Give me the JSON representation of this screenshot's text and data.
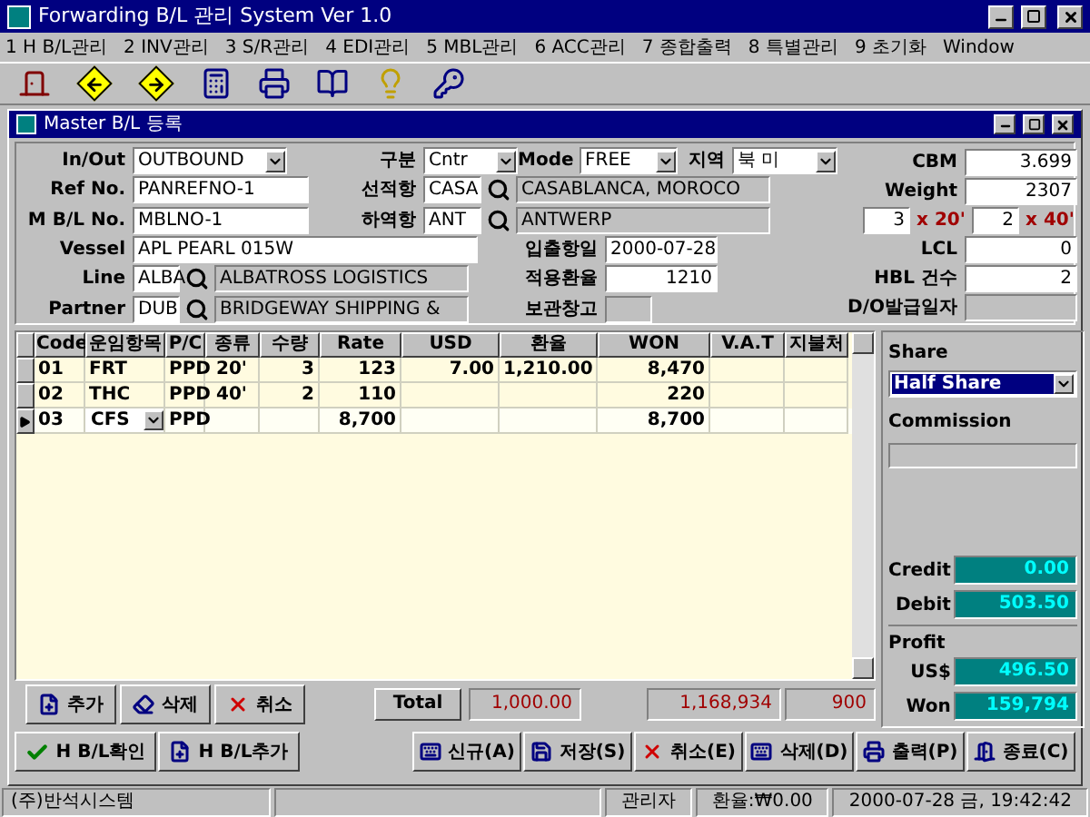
{
  "window": {
    "title": "Forwarding B/L 관리 System Ver 1.0"
  },
  "menu": [
    {
      "label": "1 H B/L관리"
    },
    {
      "label": "2 INV관리"
    },
    {
      "label": "3 S/R관리"
    },
    {
      "label": "4 EDI관리"
    },
    {
      "label": "5 MBL관리"
    },
    {
      "label": "6 ACC관리"
    },
    {
      "label": "7 종합출력"
    },
    {
      "label": "8 특별관리"
    },
    {
      "label": "9 초기화"
    },
    {
      "label": "Window"
    }
  ],
  "child_window": {
    "title": "Master B/L 등록"
  },
  "form": {
    "in_out": {
      "label": "In/Out",
      "value": "OUTBOUND"
    },
    "ref_no": {
      "label": "Ref No.",
      "value": "PANREFNO-1"
    },
    "mbl_no": {
      "label": "M B/L No.",
      "value": "MBLNO-1"
    },
    "vessel": {
      "label": "Vessel",
      "value": "APL PEARL 015W"
    },
    "line": {
      "label": "Line",
      "code": "ALBA",
      "name": "ALBATROSS LOGISTICS"
    },
    "partner": {
      "label": "Partner",
      "code": "DUB",
      "name": "BRIDGEWAY SHIPPING &"
    },
    "type": {
      "label": "구분",
      "value": "Cntr"
    },
    "mode": {
      "label": "Mode",
      "value": "FREE"
    },
    "region": {
      "label": "지역",
      "value": "북 미"
    },
    "loading_port": {
      "label": "선적항",
      "code": "CASA",
      "name": "CASABLANCA, MOROCO"
    },
    "discharge_port": {
      "label": "하역항",
      "code": "ANT",
      "name": "ANTWERP"
    },
    "date": {
      "label": "입출항일",
      "value": "2000-07-28"
    },
    "fx_rate": {
      "label": "적용환율",
      "value": "1210"
    },
    "warehouse": {
      "label": "보관창고"
    },
    "cbm": {
      "label": "CBM",
      "value": "3.699"
    },
    "weight": {
      "label": "Weight",
      "value": "2307"
    },
    "containers": [
      {
        "count": "3",
        "size": "x 20'"
      },
      {
        "count": "2",
        "size": "x 40'"
      }
    ],
    "lcl": {
      "label": "LCL",
      "value": "0"
    },
    "hbl_count": {
      "label": "HBL 건수",
      "value": "2"
    },
    "do_date": {
      "label": "D/O발급일자"
    }
  },
  "grid": {
    "columns": [
      "Code",
      "운임항목",
      "P/C",
      "종류",
      "수량",
      "Rate",
      "USD",
      "환율",
      "WON",
      "V.A.T",
      "지불처"
    ],
    "rows": [
      {
        "selected": false,
        "cells": [
          "01",
          "FRT",
          "PPD",
          "20'",
          "3",
          "123",
          "7.00",
          "1,210.00",
          "8,470",
          null,
          null
        ]
      },
      {
        "selected": false,
        "cells": [
          "02",
          "THC",
          "PPD",
          "40'",
          "2",
          "110",
          null,
          null,
          "220",
          null,
          null
        ]
      },
      {
        "selected": true,
        "cells": [
          "03",
          "CFS",
          "PPD",
          null,
          null,
          "8,700",
          null,
          null,
          "8,700",
          null,
          null
        ]
      }
    ]
  },
  "row_buttons": [
    "추가",
    "삭제",
    "취소"
  ],
  "total": {
    "label": "Total",
    "usd": "1,000.00",
    "won": "1,168,934",
    "vat": "900"
  },
  "side": {
    "share": {
      "label": "Share",
      "value": "Half Share"
    },
    "commission": {
      "label": "Commission"
    },
    "credit": {
      "label": "Credit",
      "value": "0.00"
    },
    "debit": {
      "label": "Debit",
      "value": "503.50"
    },
    "profit": {
      "label": "Profit"
    },
    "profit_usd": {
      "label": "US$",
      "value": "496.50"
    },
    "profit_won": {
      "label": "Won",
      "value": "159,794"
    }
  },
  "hbl_buttons": [
    "H B/L확인",
    "H B/L추가"
  ],
  "action_buttons": [
    "신규(A)",
    "저장(S)",
    "취소(E)",
    "삭제(D)",
    "출력(P)",
    "종료(C)"
  ],
  "status_bar": [
    {
      "text": "(주)반석시스템"
    },
    {
      "text": "관리자"
    },
    {
      "text": "환율:₩0.00"
    },
    {
      "text": "2000-07-28 금, 19:42:42"
    }
  ]
}
